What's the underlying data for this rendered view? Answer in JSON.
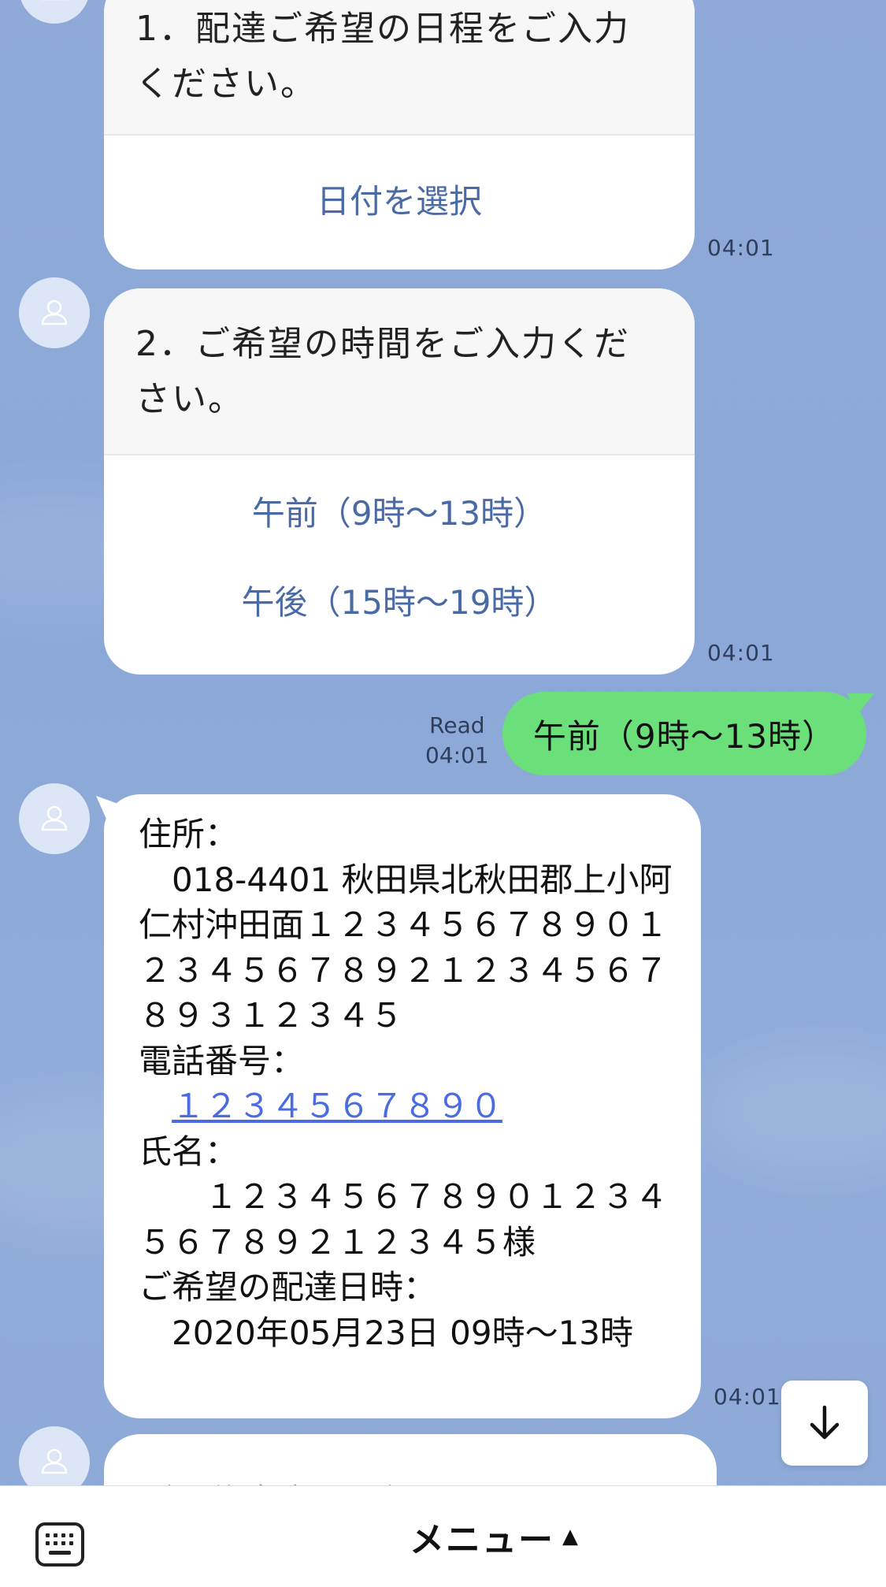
{
  "messages": {
    "card1": {
      "title": "1．配達ご希望の日程をご入力ください。",
      "action": "日付を選択",
      "time": "04:01"
    },
    "card2": {
      "title": "2．ご希望の時間をご入力ください。",
      "options": [
        "午前（9時〜13時）",
        "午後（15時〜19時）"
      ],
      "time": "04:01"
    },
    "outgoing": {
      "text": "午前（9時〜13時）",
      "read_label": "Read",
      "time": "04:01"
    },
    "summary": {
      "address_label": "住所：",
      "address_value": "　018-4401 秋田県北秋田郡上小阿仁村沖田面１２３４５６７８９０１２３４５６７８９２１２３４５６７８９３１２３４５",
      "phone_label": "電話番号：",
      "phone_value": "１２３４５６７８９０",
      "name_label": "氏名：",
      "name_value": "　　１２３４５６７８９０１２３４５６７８９２１２３４５様",
      "datetime_label": "ご希望の配達日時：",
      "datetime_value": "　2020年05月23日 09時〜13時",
      "time": "04:01"
    },
    "partial": {
      "text": "ご予約内容は上記でよろしいで"
    }
  },
  "bottom_bar": {
    "menu_label": "メニュー",
    "menu_caret": "▲",
    "keyboard_icon": "keyboard-icon"
  },
  "scroll_button": {
    "icon": "arrow-down-icon"
  },
  "colors": {
    "background": "#8ea9d8",
    "outgoing_bubble": "#6be07a",
    "link": "#4a6ce0",
    "action": "#4a6aa5"
  }
}
